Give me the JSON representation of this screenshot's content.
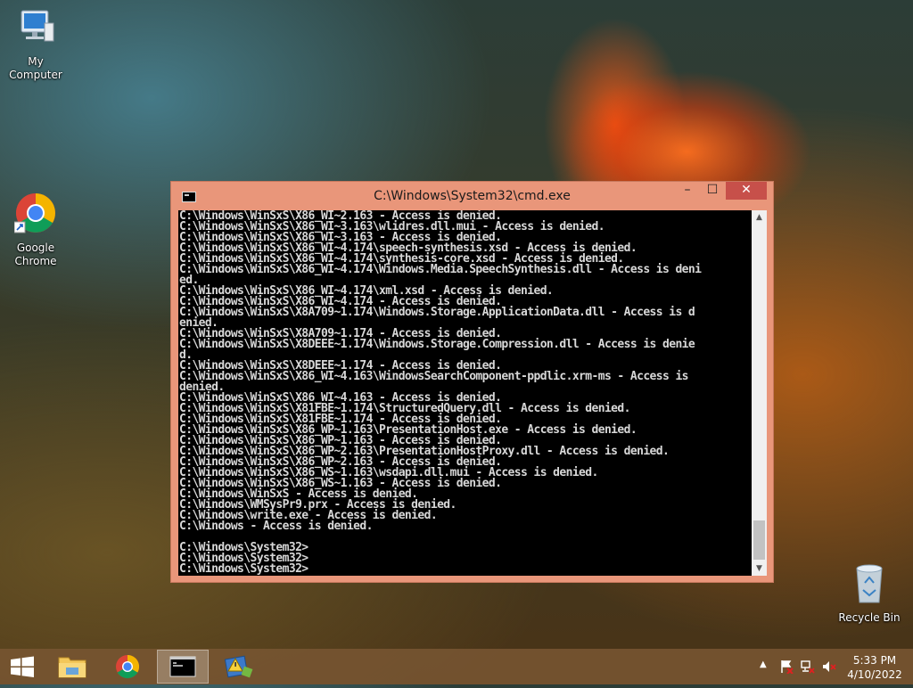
{
  "desktop": {
    "icons": [
      {
        "label": "My Computer"
      },
      {
        "label": "Google\nChrome"
      },
      {
        "label": "Recycle Bin"
      }
    ]
  },
  "window": {
    "title": "C:\\Windows\\System32\\cmd.exe",
    "controls": {
      "minimize": "–",
      "maximize": "☐",
      "close": "✕"
    },
    "console_lines": [
      "C:\\Windows\\WinSxS\\X86_WI~2.163 - Access is denied.",
      "C:\\Windows\\WinSxS\\X86_WI~3.163\\wlidres.dll.mui - Access is denied.",
      "C:\\Windows\\WinSxS\\X86_WI~3.163 - Access is denied.",
      "C:\\Windows\\WinSxS\\X86_WI~4.174\\speech-synthesis.xsd - Access is denied.",
      "C:\\Windows\\WinSxS\\X86_WI~4.174\\synthesis-core.xsd - Access is denied.",
      "C:\\Windows\\WinSxS\\X86_WI~4.174\\Windows.Media.SpeechSynthesis.dll - Access is deni",
      "ed.",
      "C:\\Windows\\WinSxS\\X86_WI~4.174\\xml.xsd - Access is denied.",
      "C:\\Windows\\WinSxS\\X86_WI~4.174 - Access is denied.",
      "C:\\Windows\\WinSxS\\X8A709~1.174\\Windows.Storage.ApplicationData.dll - Access is d",
      "enied.",
      "C:\\Windows\\WinSxS\\X8A709~1.174 - Access is denied.",
      "C:\\Windows\\WinSxS\\X8DEEE~1.174\\Windows.Storage.Compression.dll - Access is denie",
      "d.",
      "C:\\Windows\\WinSxS\\X8DEEE~1.174 - Access is denied.",
      "C:\\Windows\\WinSxS\\X86_WI~4.163\\WindowsSearchComponent-ppdlic.xrm-ms - Access is",
      "denied.",
      "C:\\Windows\\WinSxS\\X86_WI~4.163 - Access is denied.",
      "C:\\Windows\\WinSxS\\X81FBE~1.174\\StructuredQuery.dll - Access is denied.",
      "C:\\Windows\\WinSxS\\X81FBE~1.174 - Access is denied.",
      "C:\\Windows\\WinSxS\\X86_WP~1.163\\PresentationHost.exe - Access is denied.",
      "C:\\Windows\\WinSxS\\X86_WP~1.163 - Access is denied.",
      "C:\\Windows\\WinSxS\\X86_WP~2.163\\PresentationHostProxy.dll - Access is denied.",
      "C:\\Windows\\WinSxS\\X86_WP~2.163 - Access is denied.",
      "C:\\Windows\\WinSxS\\X86_WS~1.163\\wsdapi.dll.mui - Access is denied.",
      "C:\\Windows\\WinSxS\\X86_WS~1.163 - Access is denied.",
      "C:\\Windows\\WinSxS - Access is denied.",
      "C:\\Windows\\WMSysPr9.prx - Access is denied.",
      "C:\\Windows\\write.exe - Access is denied.",
      "C:\\Windows - Access is denied.",
      "",
      "C:\\Windows\\System32>",
      "C:\\Windows\\System32>",
      "C:\\Windows\\System32>"
    ]
  },
  "taskbar": {
    "clock_time": "5:33 PM",
    "clock_date": "4/10/2022",
    "tray_icons": [
      "chevron-up-icon",
      "action-center-flag-icon",
      "network-icon",
      "volume-muted-icon"
    ]
  },
  "colors": {
    "window_frame": "#e9967a",
    "close_button": "#c7504a",
    "console_bg": "#000000",
    "console_text": "#d8d8d8"
  }
}
